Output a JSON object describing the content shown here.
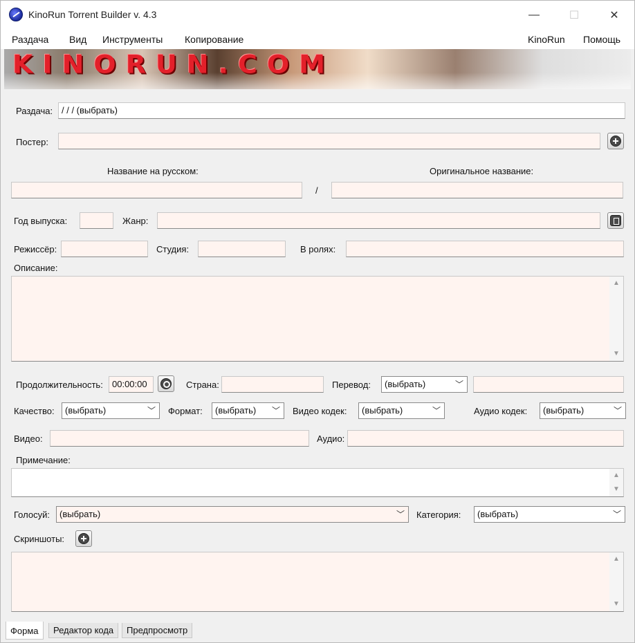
{
  "window": {
    "title": "KinoRun Torrent Builder v. 4.3",
    "min_glyph": "—",
    "max_glyph": "☐",
    "close_glyph": "✕"
  },
  "menu": {
    "items": [
      "Раздача",
      "Вид",
      "Инструменты",
      "Копирование"
    ],
    "right_items": [
      "KinoRun",
      "Помощь"
    ]
  },
  "banner": {
    "text": "KINORUN.COM"
  },
  "form": {
    "razdacha_label": "Раздача:",
    "razdacha_value": " /  /  / (выбрать)",
    "poster_label": "Постер:",
    "poster_value": "",
    "name_ru_label": "Название на русском:",
    "name_orig_label": "Оригинальное название:",
    "name_sep": "/",
    "name_ru_value": "",
    "name_orig_value": "",
    "year_label": "Год выпуска:",
    "year_value": "",
    "genre_label": "Жанр:",
    "genre_value": "",
    "director_label": "Режиссёр:",
    "director_value": "",
    "studio_label": "Студия:",
    "studio_value": "",
    "cast_label": "В ролях:",
    "cast_value": "",
    "description_label": "Описание:",
    "duration_label": "Продолжительность:",
    "duration_value": "00:00:00",
    "country_label": "Страна:",
    "country_value": "",
    "translation_label": "Перевод:",
    "translation_value": "(выбрать)",
    "translation_extra": "",
    "quality_label": "Качество:",
    "quality_value": "(выбрать)",
    "format_label": "Формат:",
    "format_value": "(выбрать)",
    "vcodec_label": "Видео кодек:",
    "vcodec_value": "(выбрать)",
    "acodec_label": "Аудио кодек:",
    "acodec_value": "(выбрать)",
    "video_label": "Видео:",
    "video_value": "",
    "audio_label": "Аудио:",
    "audio_value": "",
    "note_label": "Примечание:",
    "voices_label": "Голосуй:",
    "voices_value": "(выбрать)",
    "category_label": "Категория:",
    "category_value": "(выбрать)",
    "screenshots_label": "Скриншоты:"
  },
  "tabs": [
    "Форма",
    "Редактор кода",
    "Предпросмотр"
  ],
  "glyphs": {
    "dropdown": "﹀",
    "scroll_up": "▲",
    "scroll_down": "▼"
  },
  "icons": [
    "app-icon",
    "add-image-icon",
    "film-icon",
    "clock-icon"
  ],
  "colors": {
    "field_bg": "#fff4f0",
    "window_bg": "#f0f0f0",
    "banner_text": "#e3202a"
  }
}
